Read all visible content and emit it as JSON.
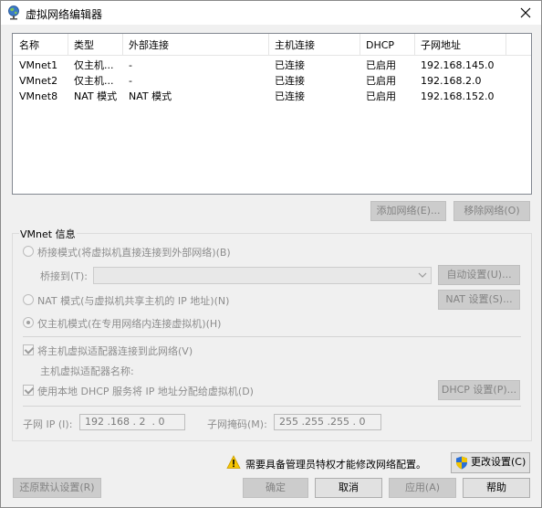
{
  "window": {
    "title": "虚拟网络编辑器",
    "icon": "vmware-network-globe-icon",
    "close_icon": "close-icon"
  },
  "table": {
    "headers": [
      "名称",
      "类型",
      "外部连接",
      "主机连接",
      "DHCP",
      "子网地址"
    ],
    "rows": [
      [
        "VMnet1",
        "仅主机...",
        "-",
        "已连接",
        "已启用",
        "192.168.145.0"
      ],
      [
        "VMnet2",
        "仅主机...",
        "-",
        "已连接",
        "已启用",
        "192.168.2.0"
      ],
      [
        "VMnet8",
        "NAT 模式",
        "NAT 模式",
        "已连接",
        "已启用",
        "192.168.152.0"
      ]
    ]
  },
  "list_buttons": {
    "add": "添加网络(E)...",
    "remove": "移除网络(O)"
  },
  "vmnet_info": {
    "legend": "VMnet 信息",
    "bridged": "桥接模式(将虚拟机直接连接到外部网络)(B)",
    "bridge_to_label": "桥接到(T):",
    "bridge_to_value": "",
    "auto_settings": "自动设置(U)...",
    "nat": "NAT 模式(与虚拟机共享主机的 IP 地址)(N)",
    "nat_settings": "NAT 设置(S)...",
    "host_only": "仅主机模式(在专用网络内连接虚拟机)(H)",
    "connect_adapter": "将主机虚拟适配器连接到此网络(V)",
    "adapter_name_label": "主机虚拟适配器名称:",
    "use_dhcp": "使用本地 DHCP 服务将 IP 地址分配给虚拟机(D)",
    "dhcp_settings": "DHCP 设置(P)...",
    "subnet_ip_label": "子网 IP (I):",
    "subnet_ip_value": "192 .168 . 2  . 0",
    "subnet_mask_label": "子网掩码(M):",
    "subnet_mask_value": "255 .255 .255 . 0",
    "selected_mode": "host_only",
    "connect_adapter_checked": true,
    "use_dhcp_checked": true
  },
  "footer": {
    "admin_notice": "需要具备管理员特权才能修改网络配置。",
    "change_settings": "更改设置(C)",
    "restore_defaults": "还原默认设置(R)",
    "ok": "确定",
    "cancel": "取消",
    "apply": "应用(A)",
    "help": "帮助"
  },
  "colors": {
    "warning": "#f7c600",
    "shield_blue": "#2a6fd6",
    "shield_yellow": "#f3c400",
    "disabled_text": "#838383"
  }
}
